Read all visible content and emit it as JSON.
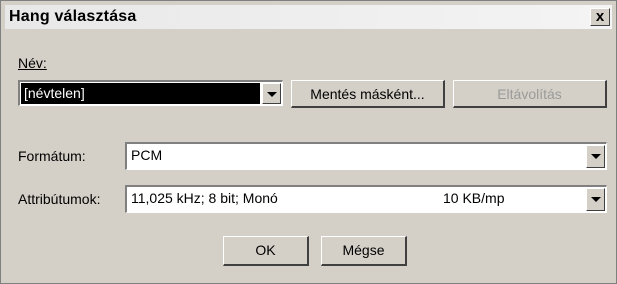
{
  "window": {
    "title": "Hang választása",
    "close_glyph": "x"
  },
  "name_section": {
    "label": "Név:",
    "value": "[névtelen]",
    "save_as_button": "Mentés másként...",
    "remove_button": "Eltávolítás"
  },
  "format": {
    "label": "Formátum:",
    "value": "PCM"
  },
  "attributes": {
    "label": "Attribútumok:",
    "value": "11,025 kHz; 8 bit; Monó",
    "rate": "10 KB/mp"
  },
  "buttons": {
    "ok": "OK",
    "cancel": "Mégse"
  }
}
